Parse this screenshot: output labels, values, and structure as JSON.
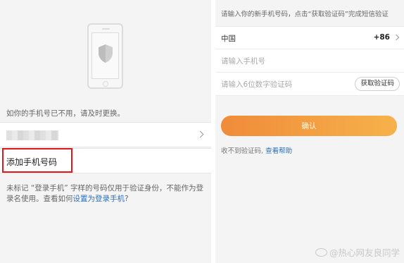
{
  "left": {
    "hint": "如你的手机号已不用，请及时更换。",
    "add_phone_label": "添加手机号码",
    "note_prefix": "未标记 “登录手机” 字样的号码仅用于验证身份，不能作为登录名使用。查看如何",
    "note_link": "设置为登录手机",
    "note_suffix": "?"
  },
  "right": {
    "hint": "请输入你的新手机号码，点击“获取验证码”完成短信验证",
    "country": "中国",
    "country_code": "+86",
    "phone_placeholder": "请输入手机号",
    "code_placeholder": "请输入6位数字验证码",
    "get_code_label": "获取验证码",
    "confirm_label": "确认",
    "no_code_text": "收不到验证码,",
    "help_link": "查看帮助"
  },
  "watermark": "@热心网友良同学",
  "colors": {
    "accent_orange": "#f08b3a",
    "link_blue": "#2a6fbd",
    "highlight_red": "#e5161b"
  }
}
